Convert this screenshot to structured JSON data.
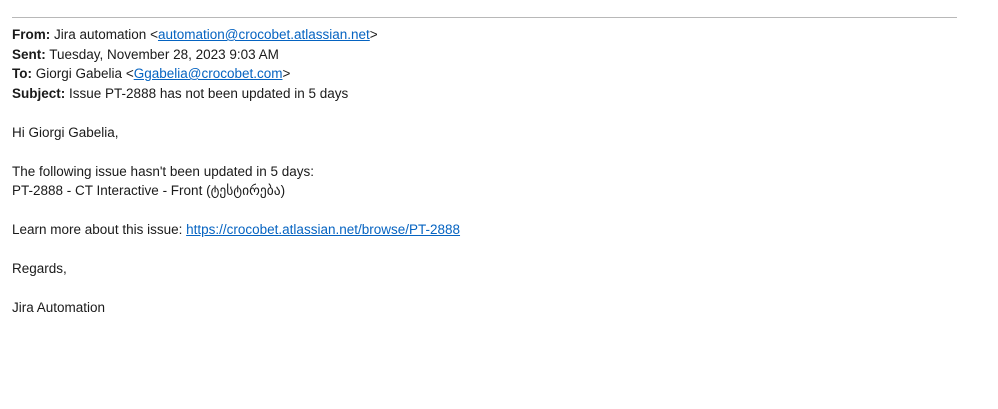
{
  "header": {
    "from_label": "From:",
    "from_name": "Jira automation",
    "from_email": "automation@crocobet.atlassian.net",
    "sent_label": "Sent:",
    "sent_value": "Tuesday, November 28, 2023 9:03 AM",
    "to_label": "To:",
    "to_name": "Giorgi Gabelia",
    "to_email": "Ggabelia@crocobet.com",
    "subject_label": "Subject:",
    "subject_value": "Issue PT-2888 has not been updated in 5 days"
  },
  "body": {
    "greeting": "Hi Giorgi Gabelia,",
    "intro": "The following issue hasn't been updated in 5 days:",
    "issue_line": "PT-2888 - CT Interactive - Front (ტესტირება)",
    "learn_more_label": "Learn more about this issue:",
    "issue_url": "https://crocobet.atlassian.net/browse/PT-2888",
    "regards": "Regards,",
    "signature": "Jira Automation"
  },
  "colors": {
    "link": "#0563c1",
    "divider": "#b8b8b8",
    "text": "#1a1a1a"
  }
}
